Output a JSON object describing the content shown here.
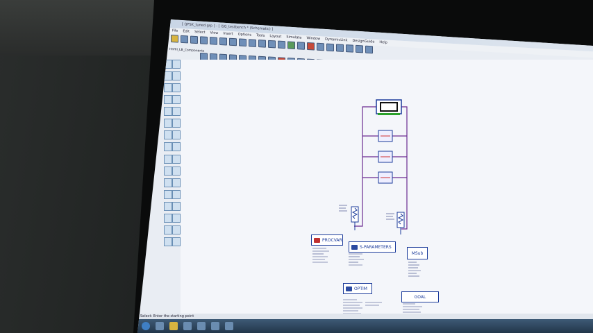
{
  "window": {
    "title": "[ QPSK_tuned.grp ] - [ iSG_testbench * (Schematic) ]"
  },
  "menu": [
    "File",
    "Edit",
    "Select",
    "View",
    "Insert",
    "Options",
    "Tools",
    "Layout",
    "Simulate",
    "Window",
    "DynamicLink",
    "DesignGuide",
    "Help"
  ],
  "toolbar": {
    "component_library": "HIVIII_LB_Components"
  },
  "blocks": {
    "var_label": "PROCVAR",
    "sparams_label": "S-PARAMETERS",
    "msub_label": "MSub",
    "optim_label": "OPTIM",
    "goal_label": "GOAL"
  },
  "status": {
    "text": "Select: Enter the starting point"
  },
  "colors": {
    "wire": "#6a2a90",
    "component_outline": "#1a3a9a",
    "component_fill": "#2aa02a"
  }
}
